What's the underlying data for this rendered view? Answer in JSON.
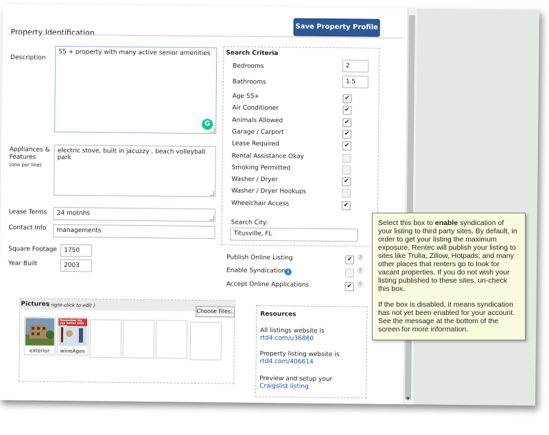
{
  "save_button": "Save Property Profile",
  "section_title": "Property Identification",
  "fields": {
    "description_label": "Description",
    "description_value": "55 + property with many active senior amenities",
    "appliances_label_line1": "Appliances &",
    "appliances_label_line2": "Features",
    "appliances_label_note": "(one per line)",
    "appliances_value": "electric stove, built in jacuzzy , beach volleyball park",
    "lease_terms_label": "Lease Terms",
    "lease_terms_value": "24 motnhs",
    "contact_info_label": "Contact Info",
    "contact_info_value": "managements",
    "square_footage_label": "Square Footage",
    "square_footage_value": "1750",
    "year_built_label": "Year Built",
    "year_built_value": "2003"
  },
  "search_criteria": {
    "title": "Search Criteria",
    "bedrooms_label": "Bedrooms",
    "bedrooms_value": "2",
    "bathrooms_label": "Bathrooms",
    "bathrooms_value": "1.5",
    "items": [
      {
        "label": "Age 55+",
        "checked": true
      },
      {
        "label": "Air Conditioner",
        "checked": true
      },
      {
        "label": "Animals Allowed",
        "checked": true
      },
      {
        "label": "Garage / Carport",
        "checked": true
      },
      {
        "label": "Lease Required",
        "checked": true
      },
      {
        "label": "Rental Assistance Okay",
        "checked": false
      },
      {
        "label": "Smoking Permitted",
        "checked": false
      },
      {
        "label": "Washer / Dryer",
        "checked": true
      },
      {
        "label": "Washer / Dryer Hookups",
        "checked": false
      },
      {
        "label": "Wheelchair Access",
        "checked": true
      }
    ],
    "search_city_label": "Search City:",
    "search_city_value": "Titusville, FL"
  },
  "listing_options": [
    {
      "label": "Publish Online Listing",
      "checked": true
    },
    {
      "label": "Enable Syndication",
      "checked": false
    },
    {
      "label": "Accept Online Applications",
      "checked": true
    }
  ],
  "pictures": {
    "title": "Pictures",
    "note": "( right-click to edit )",
    "choose_files": "Choose Files..",
    "items": [
      {
        "caption": "exterior"
      },
      {
        "caption": "wineAges"
      }
    ],
    "banner_text": "Remember his you better with wine"
  },
  "resources": {
    "title": "Resources",
    "all_listings_text": "All listings website is",
    "all_listings_link": "rtd4.com/u36880",
    "property_listing_text": "Property listing website is",
    "property_listing_link": "rtd4.com/406614",
    "craigslist_text": "Preview and setup your",
    "craigslist_link": "Craigslist listing"
  },
  "tooltip": {
    "p1_before": "Select this box to ",
    "p1_bold": "enable",
    "p1_after": " syndication of your listing to third party sites. By default, in order to get your listing the maximum exposure, Rentec will publish your listing to sites like Trulia, Zillow, Hotpads, and many other places that renters go to look for vacant properties. If you do not wish your listing published to these sites, un-check this box.",
    "p2": "If the box is disabled, it means syndication has not yet been enabled for your account. See the message at the bottom of the screen for more information."
  },
  "icons": {
    "help": "?",
    "info": "i",
    "check": "✔",
    "grammarly": "G"
  }
}
